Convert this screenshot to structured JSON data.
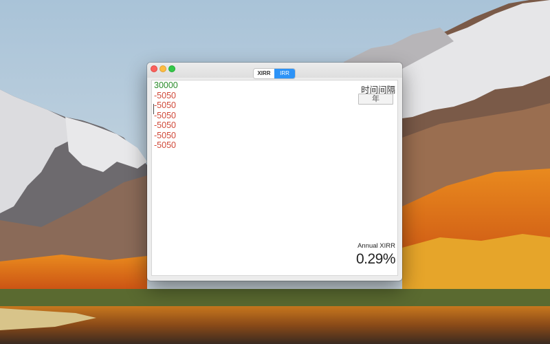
{
  "window": {
    "tabs": [
      {
        "label": "XIRR",
        "active": false
      },
      {
        "label": "IRR",
        "active": true
      }
    ]
  },
  "cashflows": [
    {
      "value": "30000",
      "sign": "positive"
    },
    {
      "value": "-5050",
      "sign": "negative"
    },
    {
      "value": "-5050",
      "sign": "negative"
    },
    {
      "value": "-5050",
      "sign": "negative"
    },
    {
      "value": "-5050",
      "sign": "negative"
    },
    {
      "value": "-5050",
      "sign": "negative"
    },
    {
      "value": "-5050",
      "sign": "negative"
    }
  ],
  "interval": {
    "label": "时间间隔",
    "selected": "年"
  },
  "result": {
    "label": "Annual XIRR",
    "value": "0.29%"
  },
  "colors": {
    "positive": "#2a8c2a",
    "negative": "#d04838",
    "accent": "#2d93f7"
  },
  "icons": [
    "close-icon",
    "minimize-icon",
    "zoom-icon"
  ]
}
